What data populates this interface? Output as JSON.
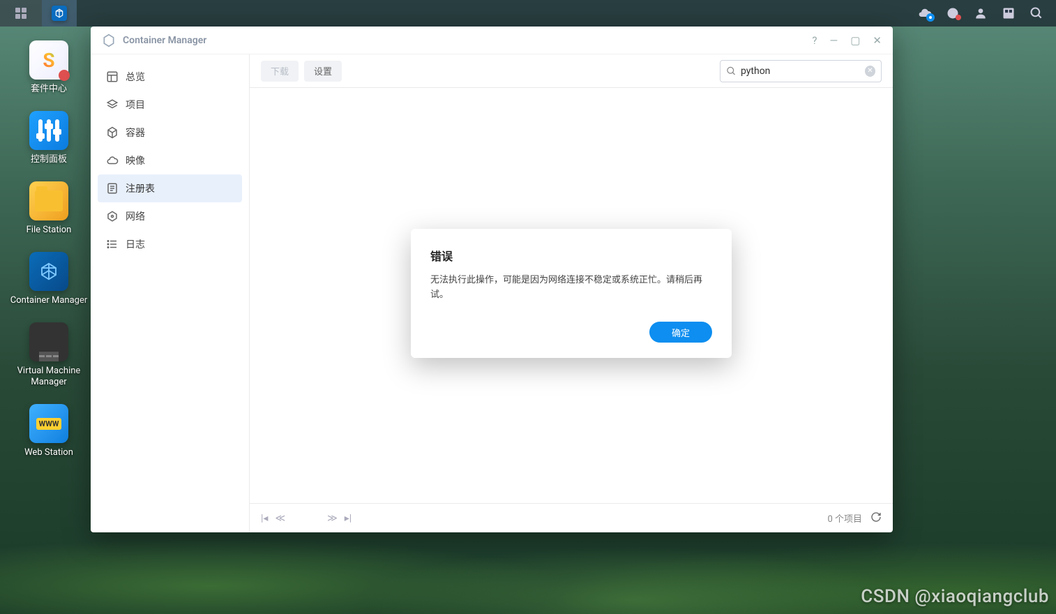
{
  "taskbar": {
    "apps_menu": "apps",
    "open_app": "Container Manager"
  },
  "desktop": {
    "items": [
      {
        "label": "套件中心"
      },
      {
        "label": "控制面板"
      },
      {
        "label": "File Station"
      },
      {
        "label": "Container Manager"
      },
      {
        "label": "Virtual Machine\nManager"
      },
      {
        "label": "Web Station"
      }
    ]
  },
  "window": {
    "title": "Container Manager"
  },
  "sidebar": {
    "items": [
      {
        "label": "总览"
      },
      {
        "label": "项目"
      },
      {
        "label": "容器"
      },
      {
        "label": "映像"
      },
      {
        "label": "注册表"
      },
      {
        "label": "网络"
      },
      {
        "label": "日志"
      }
    ]
  },
  "toolbar": {
    "download": "下载",
    "settings": "设置",
    "search_value": "python"
  },
  "footer": {
    "count_text": "0 个项目"
  },
  "modal": {
    "title": "错误",
    "message": "无法执行此操作，可能是因为网络连接不稳定或系统正忙。请稍后再试。",
    "ok": "确定"
  },
  "watermark": "CSDN @xiaoqiangclub"
}
